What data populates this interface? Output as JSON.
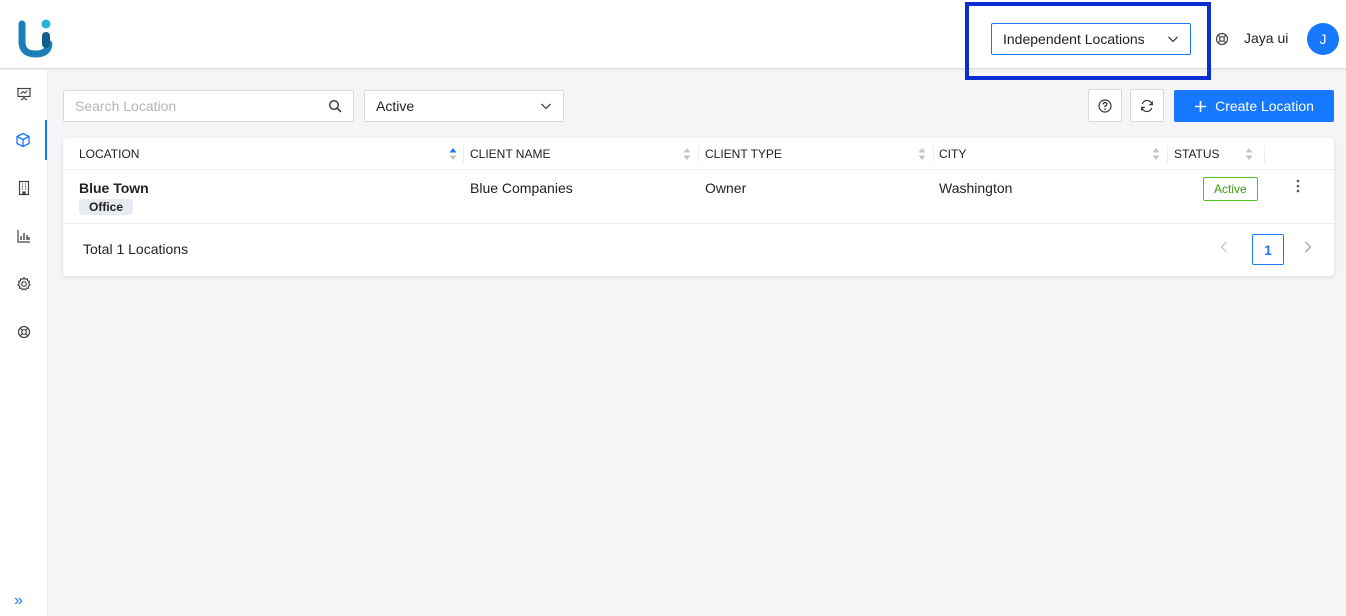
{
  "header": {
    "location_selector": "Independent Locations",
    "username": "Jaya ui",
    "avatar_initial": "J"
  },
  "sidebar": {
    "items": [
      {
        "icon": "presentation-icon"
      },
      {
        "icon": "cube-icon",
        "active": true
      },
      {
        "icon": "building-icon"
      },
      {
        "icon": "bar-chart-icon"
      },
      {
        "icon": "gear-icon"
      },
      {
        "icon": "support-icon"
      }
    ],
    "expand_label": "»"
  },
  "toolbar": {
    "search_placeholder": "Search Location",
    "status_value": "Active",
    "create_label": "Create Location"
  },
  "table": {
    "columns": [
      "LOCATION",
      "CLIENT NAME",
      "CLIENT TYPE",
      "CITY",
      "STATUS"
    ],
    "rows": [
      {
        "location": "Blue Town",
        "tag": "Office",
        "client_name": "Blue Companies",
        "client_type": "Owner",
        "city": "Washington",
        "status": "Active"
      }
    ],
    "total": "Total 1 Locations",
    "page": "1"
  },
  "colors": {
    "accent": "#1677ff",
    "highlight": "#0a2fd1",
    "status_green": "#52c41a"
  }
}
